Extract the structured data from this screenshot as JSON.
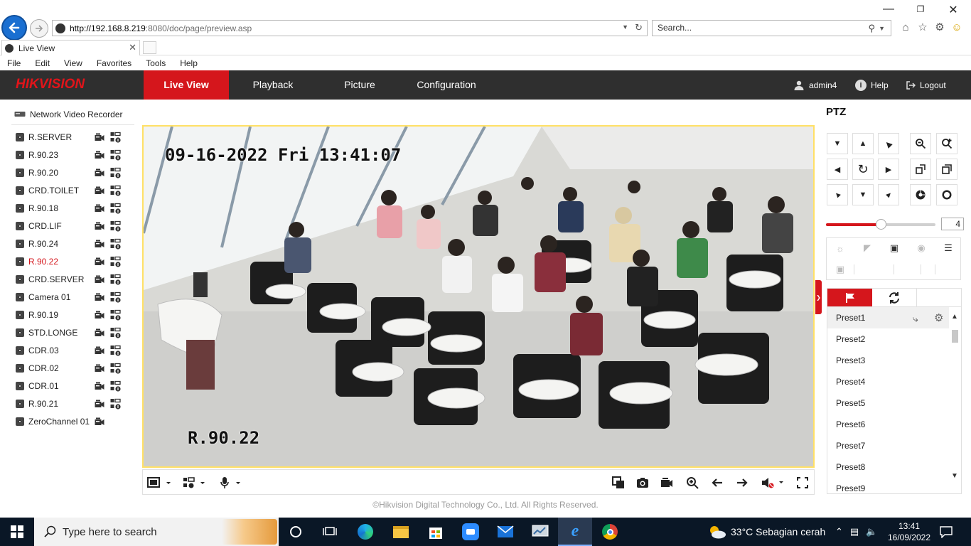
{
  "browser": {
    "address_host": "http://192.168.8.219",
    "address_path": ":8080/doc/page/preview.asp",
    "search_placeholder": "Search...",
    "tab_title": "Live View",
    "menu": [
      "File",
      "Edit",
      "View",
      "Favorites",
      "Tools",
      "Help"
    ]
  },
  "app": {
    "logo": "HIKVISION",
    "nav": [
      "Live View",
      "Playback",
      "Picture",
      "Configuration"
    ],
    "active_nav": "Live View",
    "user": "admin4",
    "help": "Help",
    "logout": "Logout"
  },
  "tree": {
    "root_label": "Network Video Recorder",
    "cameras": [
      {
        "label": "R.SERVER"
      },
      {
        "label": "R.90.23"
      },
      {
        "label": "R.90.20"
      },
      {
        "label": "CRD.TOILET"
      },
      {
        "label": "R.90.18"
      },
      {
        "label": "CRD.LIF"
      },
      {
        "label": "R.90.24"
      },
      {
        "label": "R.90.22",
        "active": true
      },
      {
        "label": "CRD.SERVER"
      },
      {
        "label": "Camera 01"
      },
      {
        "label": "R.90.19"
      },
      {
        "label": "STD.LONGE"
      },
      {
        "label": "CDR.03"
      },
      {
        "label": "CDR.02"
      },
      {
        "label": "CDR.01"
      },
      {
        "label": "R.90.21"
      },
      {
        "label": "ZeroChannel 01"
      }
    ]
  },
  "video": {
    "timestamp": "09-16-2022 Fri 13:41:07",
    "channel_name": "R.90.22"
  },
  "ptz": {
    "title": "PTZ",
    "speed": "4",
    "speed_level": 4,
    "speed_max": 7,
    "presets": [
      "Preset1",
      "Preset2",
      "Preset3",
      "Preset4",
      "Preset5",
      "Preset6",
      "Preset7",
      "Preset8",
      "Preset9"
    ]
  },
  "footer": {
    "copyright": "©Hikvision Digital Technology Co., Ltd. All Rights Reserved."
  },
  "taskbar": {
    "search_placeholder": "Type here to search",
    "weather": "33°C  Sebagian cerah",
    "time": "13:41",
    "date": "16/09/2022"
  },
  "colors": {
    "accent": "#d5161c",
    "header_bg": "#2f2f2f",
    "taskbar_bg": "#0a1726"
  }
}
